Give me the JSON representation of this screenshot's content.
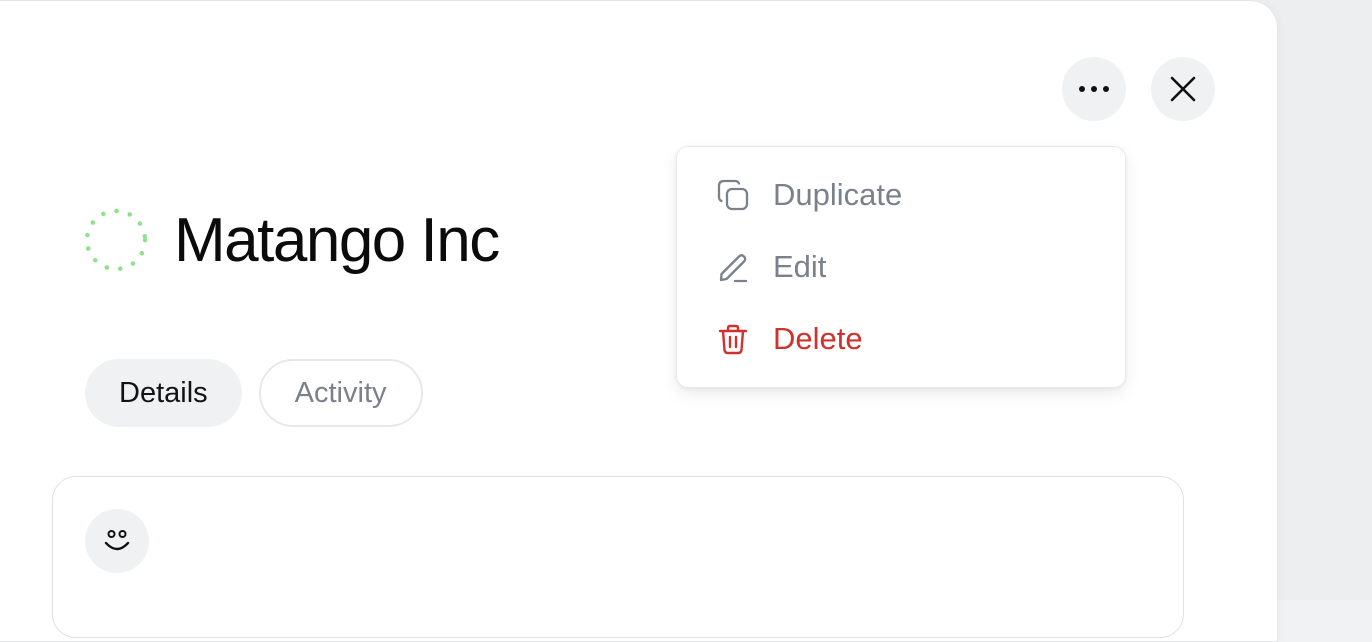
{
  "header": {
    "more_icon": "more-horizontal-icon",
    "close_icon": "close-icon"
  },
  "record": {
    "title": "Matango Inc",
    "status_icon": "dotted-circle-status-icon",
    "status_color": "#8ee28c"
  },
  "tabs": [
    {
      "label": "Details",
      "active": true
    },
    {
      "label": "Activity",
      "active": false
    }
  ],
  "card": {
    "emoji_icon": "smiley-icon"
  },
  "menu": {
    "items": [
      {
        "label": "Duplicate",
        "icon": "copy-icon",
        "color": "#7b818b"
      },
      {
        "label": "Edit",
        "icon": "pencil-icon",
        "color": "#7b818b"
      },
      {
        "label": "Delete",
        "icon": "trash-icon",
        "color": "#d0312d"
      }
    ]
  }
}
